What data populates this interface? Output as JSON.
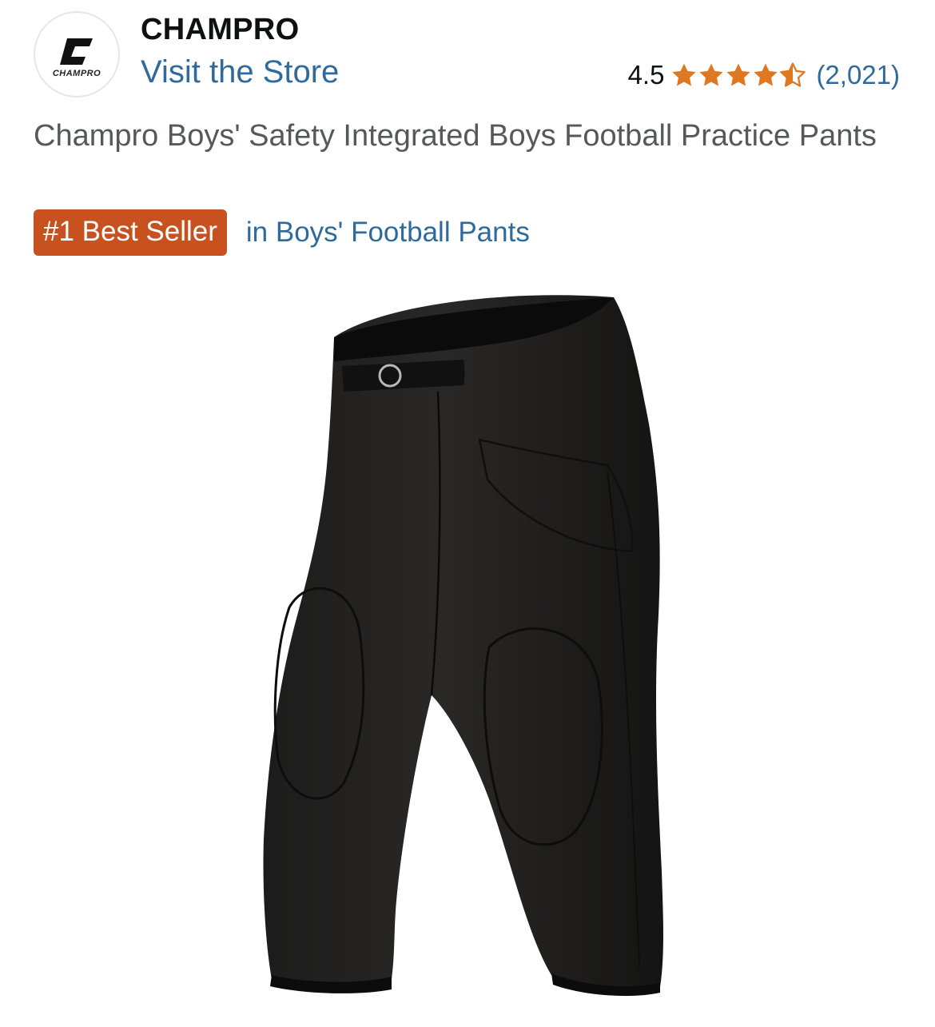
{
  "brand": {
    "logo_text": "CHAMPRO",
    "name": "CHAMPRO",
    "store_link": "Visit the Store"
  },
  "rating": {
    "value": "4.5",
    "stars": 4.5,
    "max_stars": 5,
    "review_count": "(2,021)",
    "star_color": "#de7921"
  },
  "product": {
    "title": "Champro Boys' Safety Integrated Boys Football Practice Pants",
    "image_icon": "football-pants-image"
  },
  "badge": {
    "label": "#1 Best Seller",
    "category": "in Boys' Football Pants",
    "color": "#c7511f"
  },
  "colors": {
    "link": "#2f6a9c",
    "title_text": "#565959"
  }
}
